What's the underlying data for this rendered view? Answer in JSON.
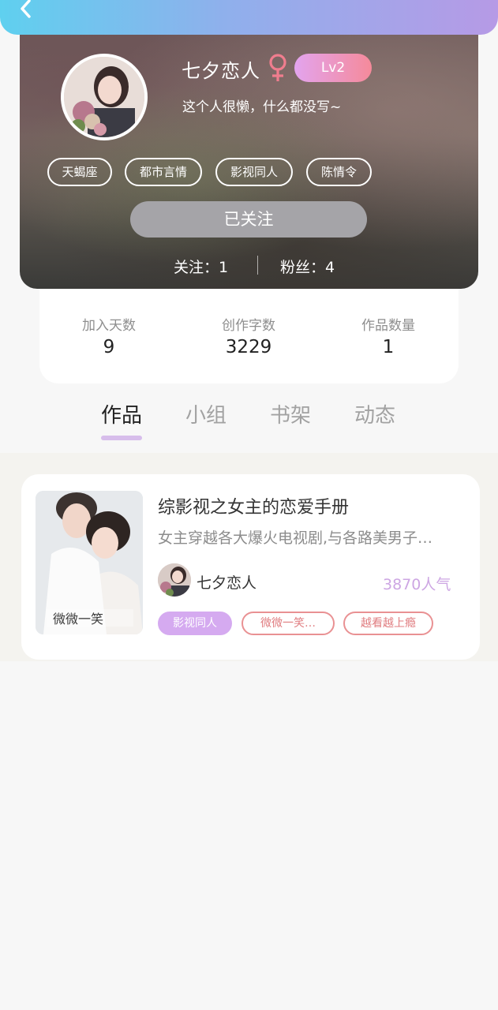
{
  "profile": {
    "name": "七夕恋人",
    "level": "Lv2",
    "signature": "这个人很懒，什么都没写~",
    "tags": [
      "天蝎座",
      "都市言情",
      "影视同人",
      "陈情令"
    ],
    "follow_button": "已关注",
    "following": "关注：1",
    "fans": "粉丝：4"
  },
  "stats": [
    {
      "label": "加入天数",
      "value": "9"
    },
    {
      "label": "创作字数",
      "value": "3229"
    },
    {
      "label": "作品数量",
      "value": "1"
    }
  ],
  "tabs": [
    "作品",
    "小组",
    "书架",
    "动态"
  ],
  "active_tab": "作品",
  "work": {
    "title": "综影视之女主的恋爱手册",
    "description": "女主穿越各大爆火电视剧,与各路美男子…",
    "author": "七夕恋人",
    "popularity": "3870人气",
    "tags": [
      "影视同人",
      "微微一笑…",
      "越看越上瘾"
    ]
  },
  "colors": {
    "header_gradient_start": "#5fd0ef",
    "header_gradient_end": "#b69ae6",
    "level_badge_start": "#e3a4ee",
    "level_badge_end": "#f58a9a",
    "gender_icon": "#f07d8e",
    "tab_indicator": "#d7bdeb",
    "popularity": "#cda6e3",
    "tag_filled": "#d5aaf0",
    "tag_outline": "#e99193"
  },
  "icons": {
    "back": "chevron-left-icon",
    "gender": "female-icon"
  }
}
